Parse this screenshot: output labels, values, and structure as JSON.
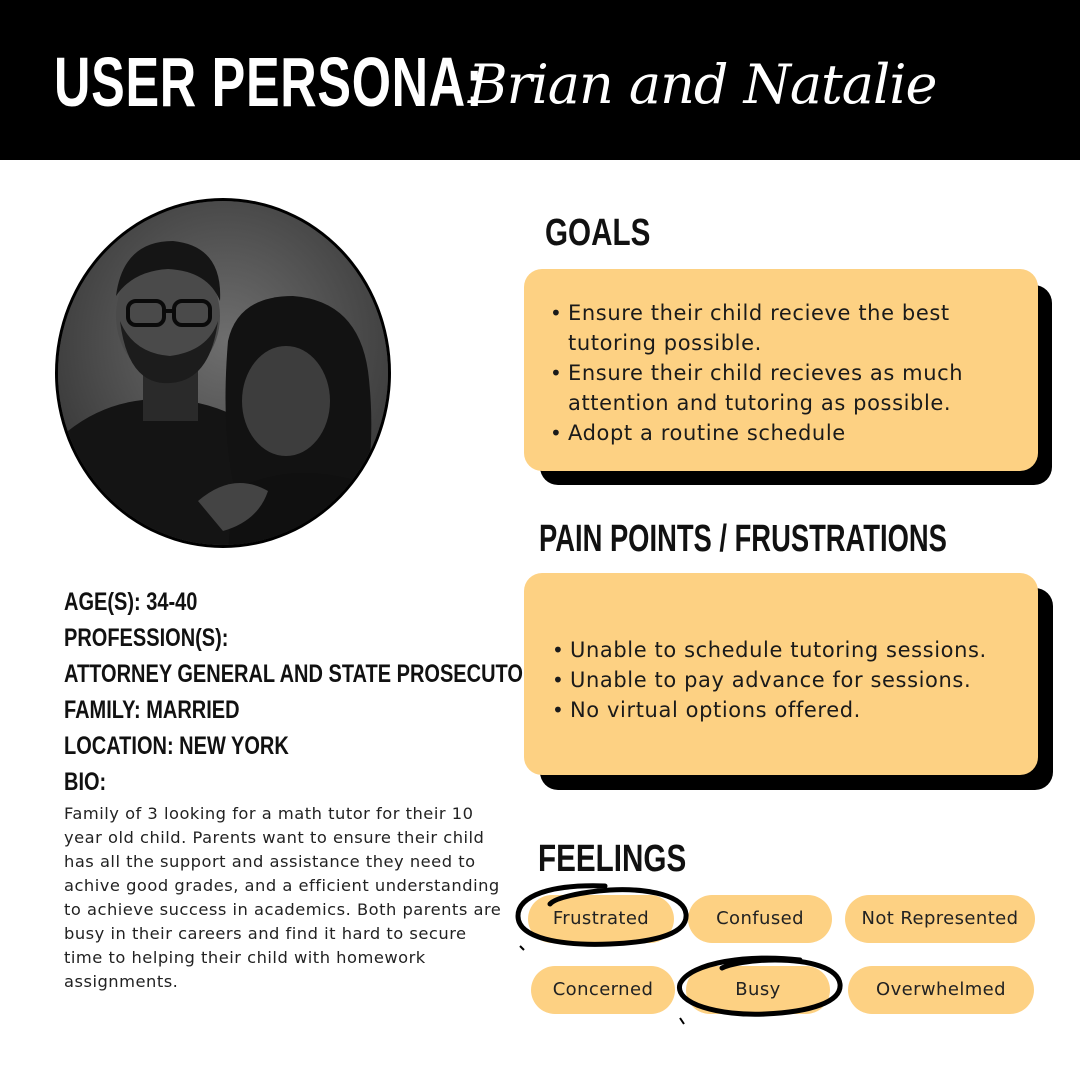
{
  "header": {
    "title": "USER PERSONA:",
    "names": "Brian and Natalie"
  },
  "photo": {
    "alt": "Black and white portrait of a couple"
  },
  "info": {
    "age": "AGE(S): 34-40",
    "profession_label": "PROFESSION(S):",
    "profession_value": "ATTORNEY GENERAL AND STATE PROSECUTOR",
    "family": "FAMILY: MARRIED",
    "location": "LOCATION: NEW YORK",
    "bio_label": "BIO:",
    "bio": "Family of 3 looking for a math tutor for their 10 year old child. Parents want to ensure their child has all the support and assistance they need to achive good grades, and a efficient understanding to achieve success in academics. Both parents are busy in their careers and find it hard to secure time to helping their child with homework assignments."
  },
  "goals": {
    "heading": "GOALS",
    "items": [
      "Ensure their child recieve the best tutoring possible.",
      "Ensure their child recieves as much attention and tutoring as possible.",
      "Adopt a routine schedule"
    ]
  },
  "pain_points": {
    "heading": "PAIN POINTS / FRUSTRATIONS",
    "items": [
      "Unable to schedule tutoring sessions.",
      "Unable to pay advance for sessions.",
      "No virtual options offered."
    ]
  },
  "feelings": {
    "heading": "FEELINGS",
    "chips": [
      {
        "label": "Frustrated",
        "circled": true
      },
      {
        "label": "Confused",
        "circled": false
      },
      {
        "label": "Not Represented",
        "circled": false
      },
      {
        "label": "Concerned",
        "circled": false
      },
      {
        "label": "Busy",
        "circled": true
      },
      {
        "label": "Overwhelmed",
        "circled": false
      }
    ]
  },
  "colors": {
    "card": "#fdd183",
    "header": "#000000",
    "text": "#111111"
  }
}
